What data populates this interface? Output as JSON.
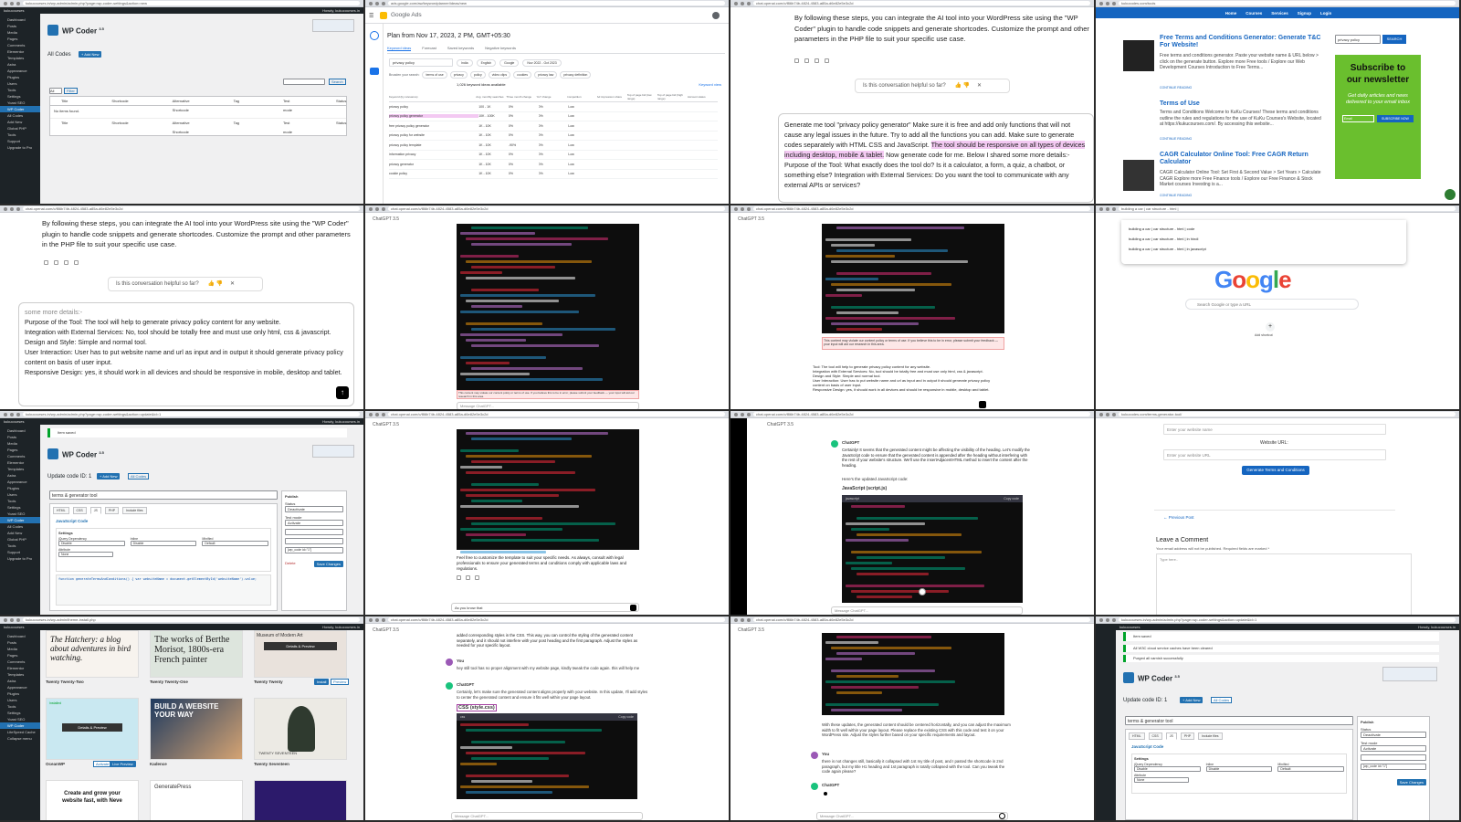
{
  "urls": {
    "wp_settings": "kukucourses.in/wp-admin/admin.php?page=wp-coder-settings&action=new",
    "ads": "ads.google.com/aw/keywordplanner/ideas/new",
    "chat": "chat.openai.com/c/f86b74b-4824-4583-a85a-d6e82e5e3c2d",
    "kuku": "kukucodes.com/tools",
    "wp_update": "kukucourses.in/wp-admin/admin.php?page=wp-coder-settings&action=update&id=1",
    "google": "google.com",
    "wp_themes": "kukucourses.in/wp-admin/theme-install.php",
    "kuku_gen": "kukucodes.com/terms-generator-tool/"
  },
  "wp": {
    "site": "kukucourses",
    "howdy": "Howdy, kukucourses.in",
    "title": "WP Coder",
    "version": "3.5",
    "all_codes": "All Codes",
    "add_new": "+ Add New",
    "search": "Search",
    "filter": "Filter",
    "all": "All",
    "cols": [
      "Title",
      "Shortcode",
      "Alternative Shortcode",
      "Tag",
      "Test mode",
      "Status"
    ],
    "no_items": "No items found.",
    "menu": [
      "Dashboard",
      "Posts",
      "Media",
      "Pages",
      "Comments",
      "Elementor",
      "Templates",
      "Astra",
      "Appearance",
      "Plugins",
      "Users",
      "Tools",
      "Settings",
      "Yoast SEO",
      "WP Coder",
      "All Codes",
      "Add New",
      "Global PHP",
      "Tools",
      "Support",
      "Upgrade to Pro"
    ],
    "item_saved": "Item saved",
    "update_title": "Update code ID: 1",
    "all_codes_btn": "All Codes",
    "code_title": "terms & generator tool",
    "tabs": [
      "HTML",
      "CSS",
      "JS",
      "PHP",
      "Include files"
    ],
    "js_code": "JavaScript Code",
    "settings": "Settings",
    "jquery_dep": "jQuery Dependency",
    "disable": "Disable",
    "inline": "Inline",
    "minified": "Minified",
    "defaults": "Default",
    "attribute": "Attribute",
    "none": "None",
    "publish": "Publish",
    "status": "Status",
    "deactivate": "Deactivate",
    "test_mode": "Test mode",
    "activate": "Activate",
    "shortcode": "[wp_code id=\"1\"]",
    "delete": "Delete",
    "save_changes": "Save Changes",
    "code_snip": "function generateTermsAndConditions() { var websiteName = document.getElementById('websiteName').value;",
    "notice1": "All W3C cloud service caches have been cleared",
    "notice2": "Purged all varnish successfully"
  },
  "ads": {
    "brand": "Google Ads",
    "plan": "Plan from Nov 17, 2023, 2 PM, GMT+05:30",
    "tabs": [
      "Keyword ideas",
      "Forecast",
      "Saved keywords",
      "Negative keywords"
    ],
    "search_term": "privacy policy",
    "filters": [
      "India",
      "English",
      "Google",
      "Nov 2022 - Oct 2023"
    ],
    "broaden": "Broaden your search:",
    "chips": [
      "terms of use",
      "privacy",
      "policy",
      "video clips",
      "cookies",
      "privacy law",
      "privacy definition"
    ],
    "count": "1,026 keyword ideas available",
    "cols": [
      "Keyword (by relevance)",
      "Avg. monthly searches",
      "Three month change",
      "YoY change",
      "Competition",
      "Ad impression share",
      "Top of page bid (low range)",
      "Top of page bid (high range)",
      "Account status"
    ],
    "rows": [
      [
        "privacy policy",
        "100 - 1K",
        "0%",
        "0%",
        "Low"
      ],
      [
        "privacy policy generator",
        "10K - 100K",
        "0%",
        "0%",
        "Low"
      ],
      [
        "free privacy policy generator",
        "1K - 10K",
        "0%",
        "0%",
        "Low"
      ],
      [
        "privacy policy for website",
        "1K - 10K",
        "0%",
        "0%",
        "Low"
      ],
      [
        "privacy policy template",
        "1K - 10K",
        "-90%",
        "0%",
        "Low"
      ],
      [
        "information privacy",
        "1K - 10K",
        "0%",
        "0%",
        "Low"
      ],
      [
        "privacy generator",
        "1K - 10K",
        "0%",
        "0%",
        "Low"
      ],
      [
        "cookie policy",
        "1K - 10K",
        "0%",
        "0%",
        "Low"
      ]
    ],
    "keyword_view": "Keyword view"
  },
  "chat": {
    "gpt_label": "ChatGPT 3.5",
    "p1": "By following these steps, you can integrate the AI tool into your WordPress site using the \"WP Coder\" plugin to handle code snippets and generate shortcodes. Customize the prompt and other parameters in the PHP file to suit your specific use case.",
    "helpful": "Is this conversation helpful so far?",
    "prompt_a": "Generate me tool \"privacy policy generator\" Make sure it is free and add only functions that will not cause any legal issues in the future. Try to add all the functions you can add. Make sure to generate codes separately with HTML CSS and JavaScript.",
    "prompt_hl": "The tool should be responsive on all types of devices including desktop, mobile & tablet.",
    "prompt_b": "Now generate code for me. Below I shared some more details:-",
    "prompt_c": "Purpose of the Tool: What exactly does the tool do? Is it a calculator, a form, a quiz, a chatbot, or something else? Integration with External Services: Do you want the tool to communicate with any external APIs or services?",
    "some_more": "some more details:-",
    "d1a": "Purpose of the ",
    "d1b": "Tool: The tool will help to generate privacy policy content for any website.",
    "d2": "Integration with External Services: No, tool should be totally free and must use only html, css & javascript.",
    "d3": "Design and Style: Simple and normal tool.",
    "d4": "User Interaction: User has to put website name and url as input and in output it should generate privacy policy content on basis of user input.",
    "d5": "Responsive Design: yes, it should work in all devices and should be responsive in mobile, desktop and tablet.",
    "violation": "This content may violate our content policy or terms of use. If you believe this to be in error, please submit your feedback — your input will aid our research in this area.",
    "message": "Message ChatGPT...",
    "feel_free": "Feel free to customize the template to suit your specific needs. As always, consult with legal professionals to ensure your generated terms and conditions comply with applicable laws and regulations.",
    "you_know": "As you know that",
    "chatgpt": "ChatGPT",
    "you": "You",
    "certainly": "Certainly! It seems that the generated content might be affecting the visibility of the heading. Let's modify the JavaScript code to ensure that the generated content is appended after the heading without interfering with the rest of your website's structure. We'll use the insertAdjacentHTML method to insert the content after the heading.",
    "updated_js": "Here's the updated JavaScript code:",
    "js_title": "JavaScript (script.js)",
    "javascript": "javascript",
    "copy": "Copy code",
    "added_styles": "added corresponding styles in the CSS. This way, you can control the styling of the generated content separately, and it should not interfere with your post heading and the first paragraph. Adjust the styles as needed for your specific layout.",
    "you_msg1": "hey still tool has no proper alignment with my website page, kindly tweak the code again. this will help me",
    "certainly2": "Certainly, let's make sure the generated content aligns properly with your website. In this update, I'll add styles to center the generated content and ensure it fits well within your page layout.",
    "css_title": "CSS (style.css)",
    "css": "css",
    "with_these": "With these updates, the generated content should be centered horizontally, and you can adjust the maximum width to fit well within your page layout. Please replace the existing CSS with this code and test it on your WordPress site. Adjust the styles further based on your specific requirements and layout.",
    "you_msg2": "there is not changes still, basically it collapsed with 1st my title of post, and I pasted the shortcode in 2nd paragraph, but my title H1 heading and 1st paragraph is totally collapsed with the tool. Can you tweak the code again please?"
  },
  "kuku": {
    "nav": [
      "Home",
      "Courses",
      "Services",
      "Signup",
      "Login"
    ],
    "post1_title": "Free Terms and Conditions Generator: Generate T&C For Website!",
    "post1_body": "Free terms and conditions generator. Paste your website name & URL below > click on the generate button. Explore more Free tools / Explore our Web Development Courses Introduction to Free Terms...",
    "continue": "CONTINUE READING",
    "terms_title": "Terms of Use",
    "terms_body": "Terms and Conditions Welcome to KuKu Courses! These terms and conditions outline the rules and regulations for the use of KuKu Courses's Website, located at https://kukucourses.com/. By accessing this website...",
    "post3_title": "CAGR Calculator Online Tool: Free CAGR Return Calculator",
    "post3_body": "CAGR Calculator Online Tool: Set First & Second Value > Set Years > Calculate CAGR Explore more Free Finance tools / Explore our Free Finance & Stock Market courses Investing is a...",
    "search_val": "privacy policy",
    "search_btn": "SEARCH",
    "sub_title": "Subscribe to our newsletter",
    "sub_body": "Get daily articles and news delivered to your email inbox",
    "email_ph": "Email",
    "sub_btn": "SUBSCRIBE NOW",
    "website_name_ph": "Enter your website name",
    "website_url": "Website URL:",
    "website_url_ph": "Enter your website URL",
    "generate": "Generate Terms and Conditions",
    "prev_post": "← Previous Post",
    "leave": "Leave a Comment",
    "leave_sub": "Your email address will not be published. Required fields are marked *",
    "type_here": "Type here.."
  },
  "google": {
    "query": "building a car | car structure - html |",
    "sugg": [
      "building a car | car structure - html | code",
      "building a car | car structure - html | in hindi",
      "building a car | car structure - html | in javascript"
    ],
    "logo": "Google",
    "search_ph": "Search Google or type a URL",
    "shortcut": "Add shortcut"
  },
  "themes": {
    "t1": "The Hatchery: a blog about adventures in bird watching.",
    "t1_name": "Twenty Twenty-Two",
    "t2": "The works of Berthe Morisot, 1800s-era French painter",
    "t2_name": "Twenty Twenty-One",
    "t3": "Museum of Modern Art",
    "t3_name": "Twenty Twenty",
    "details": "Details & Preview",
    "install": "Install",
    "preview": "Preview",
    "t4_name": "OceanWP",
    "activate": "Activate",
    "live_preview": "Live Preview",
    "t5_name": "Kadence",
    "t5_txt": "BUILD A WEBSITE YOUR WAY",
    "t6_name": "Twenty Seventeen",
    "t6_txt": "TWENTY SEVENTEEN",
    "t7": "Create and grow your website fast, with Neve",
    "t8_name": "GeneratePress",
    "installed": "Installed",
    "menu": [
      "Dashboard",
      "Posts",
      "Media",
      "Pages",
      "Comments",
      "Elementor",
      "Templates",
      "Astra",
      "Appearance",
      "Plugins",
      "Users",
      "Tools",
      "Settings",
      "Yoast SEO",
      "WP Coder",
      "LiteSpeed Cache",
      "Collapse menu"
    ]
  },
  "colors": {
    "wp_blue": "#2271b1",
    "wp_dark": "#1d2327",
    "kuku_blue": "#1565c0",
    "green": "#6abf2e",
    "purple_hl": "#f3c9f2"
  }
}
